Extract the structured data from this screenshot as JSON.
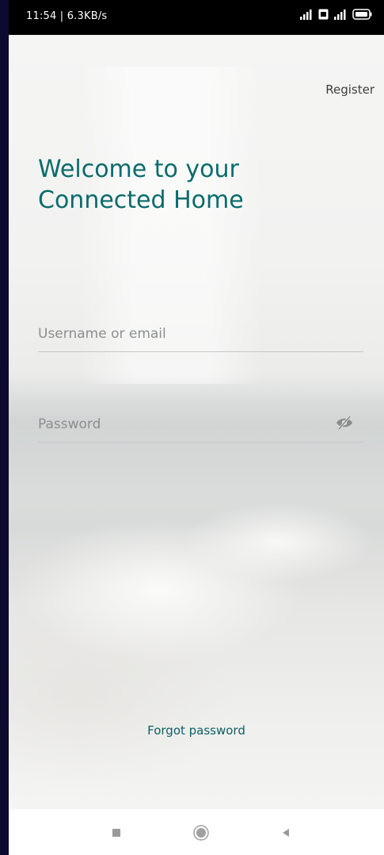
{
  "status_bar": {
    "time_speed": "11:54 | 6.3KB/s",
    "icons": [
      "signal-icon",
      "sim-icon",
      "signal-icon",
      "battery-icon"
    ]
  },
  "header": {
    "register_label": "Register"
  },
  "main": {
    "welcome_line1": "Welcome to your",
    "welcome_line2": "Connected Home",
    "username": {
      "value": "",
      "placeholder": "Username or email"
    },
    "password": {
      "value": "",
      "placeholder": "Password",
      "toggle_icon": "eye-off-icon"
    },
    "forgot_label": "Forgot password"
  },
  "nav_bar": {
    "buttons": [
      "recents-icon",
      "home-icon",
      "back-icon"
    ]
  },
  "colors": {
    "accent": "#0a6b6b",
    "link": "#0d5e66",
    "status_bar": "#000000",
    "nav_bar": "#ffffff"
  }
}
